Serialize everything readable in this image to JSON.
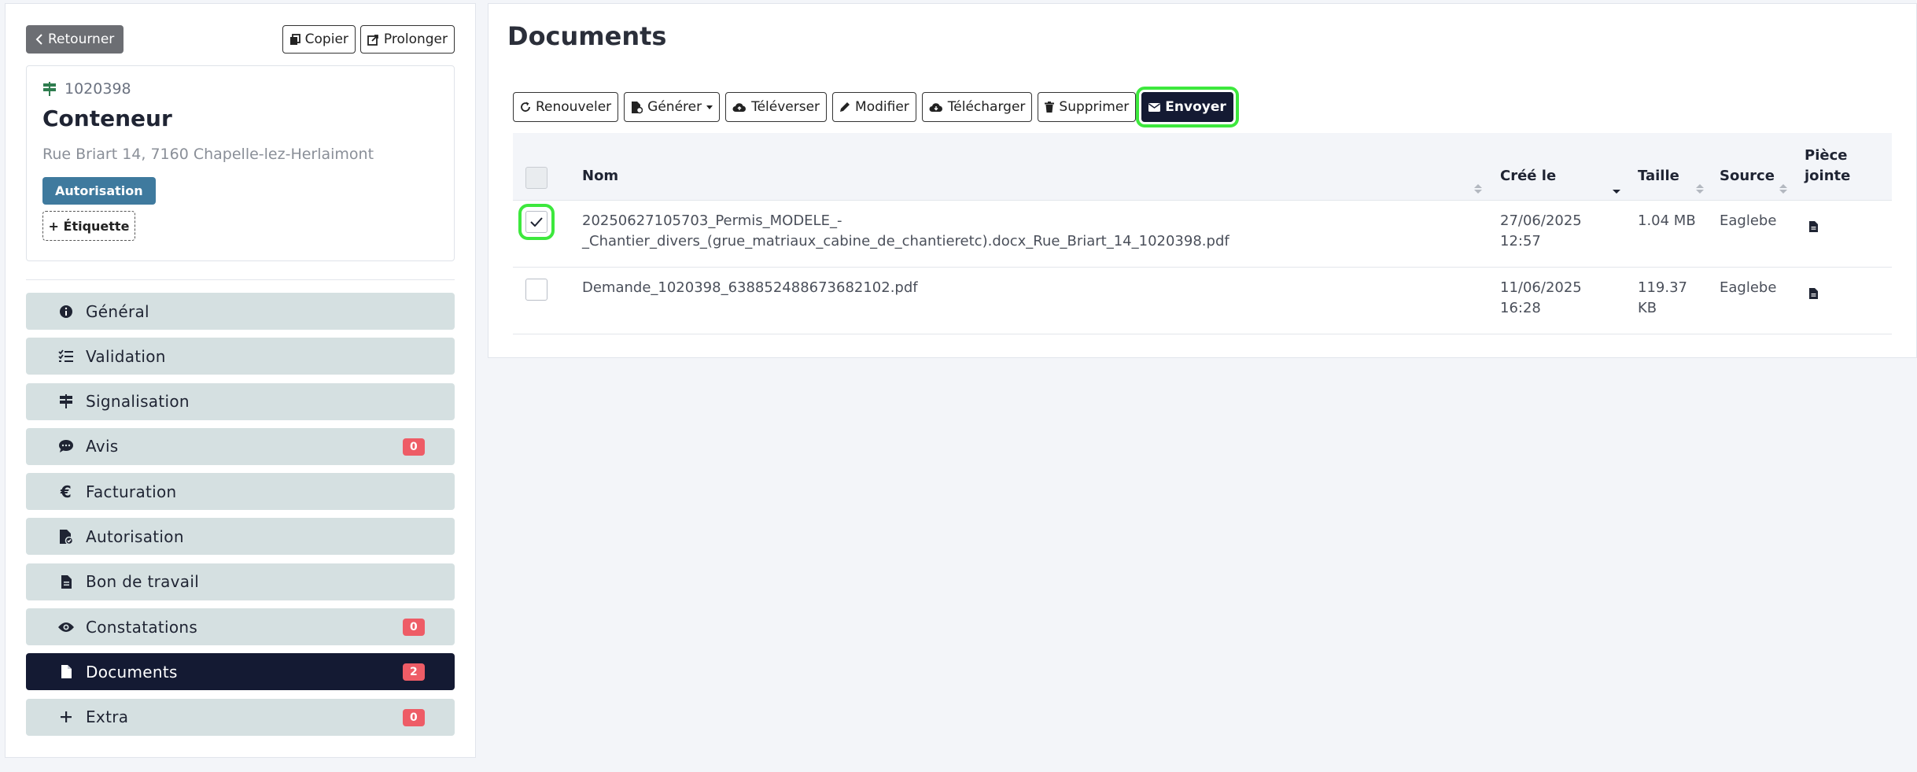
{
  "sidebar": {
    "back_label": "Retourner",
    "copy_label": "Copier",
    "extend_label": "Prolonger",
    "card": {
      "id": "1020398",
      "title": "Conteneur",
      "address": "Rue Briart 14, 7160 Chapelle-lez-Herlaimont",
      "badge": "Autorisation",
      "add_tag_label": "+ Étiquette"
    },
    "nav": [
      {
        "label": "Général",
        "icon": "info-icon",
        "count": null
      },
      {
        "label": "Validation",
        "icon": "checklist-icon",
        "count": null
      },
      {
        "label": "Signalisation",
        "icon": "signpost-icon",
        "count": null
      },
      {
        "label": "Avis",
        "icon": "comment-icon",
        "count": "0"
      },
      {
        "label": "Facturation",
        "icon": "euro-icon",
        "count": null
      },
      {
        "label": "Autorisation",
        "icon": "file-check-icon",
        "count": null
      },
      {
        "label": "Bon de travail",
        "icon": "file-text-icon",
        "count": null
      },
      {
        "label": "Constatations",
        "icon": "eye-icon",
        "count": "0"
      },
      {
        "label": "Documents",
        "icon": "file-icon",
        "count": "2",
        "active": true
      },
      {
        "label": "Extra",
        "icon": "plus-icon",
        "count": "0"
      }
    ]
  },
  "main": {
    "title": "Documents",
    "toolbar": {
      "renew": "Renouveler",
      "generate": "Générer",
      "upload": "Téléverser",
      "edit": "Modifier",
      "download": "Télécharger",
      "delete": "Supprimer",
      "send": "Envoyer"
    },
    "table": {
      "headers": {
        "name": "Nom",
        "created": "Créé le",
        "size": "Taille",
        "source": "Source",
        "attachment_1": "Pièce",
        "attachment_2": "jointe"
      },
      "rows": [
        {
          "checked": true,
          "name_1": "20250627105703_Permis_MODELE_-",
          "name_2": "_Chantier_divers_(grue_matriaux_cabine_de_chantieretc).docx_Rue_Briart_14_1020398.pdf",
          "date": "27/06/2025",
          "time": "12:57",
          "size_1": "1.04 MB",
          "size_2": "",
          "source": "Eaglebe"
        },
        {
          "checked": false,
          "name_1": "Demande_1020398_638852488673682102.pdf",
          "name_2": "",
          "date": "11/06/2025",
          "time": "16:28",
          "size_1": "119.37",
          "size_2": "KB",
          "source": "Eaglebe"
        }
      ]
    }
  },
  "colors": {
    "primary": "#141a33",
    "badge": "#3f7a9e",
    "count": "#ee5c66",
    "nav_bg": "#d5e0e1",
    "highlight": "#3de83d"
  }
}
